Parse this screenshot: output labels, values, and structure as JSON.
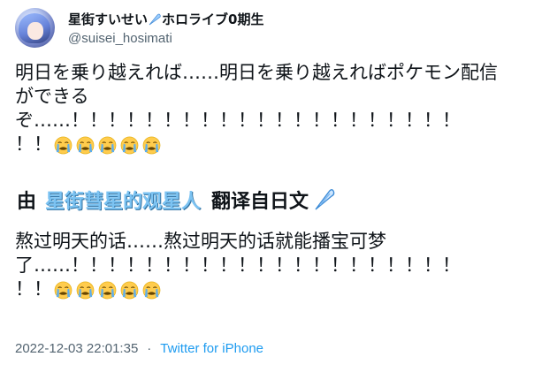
{
  "author": {
    "display_name_part1": "星街すいせい",
    "display_name_part2": "ホロライブ0期生",
    "handle": "@suisei_hosimati",
    "comet_icon": "comet-icon"
  },
  "tweet": {
    "line1": "明日を乗り越えれば……明日を乗り越えればポケモン配信",
    "line2": "ができる",
    "line3": "ぞ……！！！！！！！！！！！！！！！！！！！！！",
    "line4": "！！",
    "emoji": "loudly-crying-face",
    "emoji_count": 5
  },
  "translation_banner": {
    "prefix": "由",
    "translator": "星街彗星的观星人",
    "suffix": "翻译自日文"
  },
  "translated": {
    "line1": "熬过明天的话……熬过明天的话就能播宝可梦",
    "line2": "了……！！！！！！！！！！！！！！！！！！！！！",
    "line3": "！！"
  },
  "meta": {
    "timestamp": "2022-12-03 22:01:35",
    "separator": "·",
    "source": "Twitter for iPhone"
  },
  "colors": {
    "source_link": "#1d9bf0",
    "muted": "#536471",
    "translator_blue": "#7cc3f2"
  }
}
